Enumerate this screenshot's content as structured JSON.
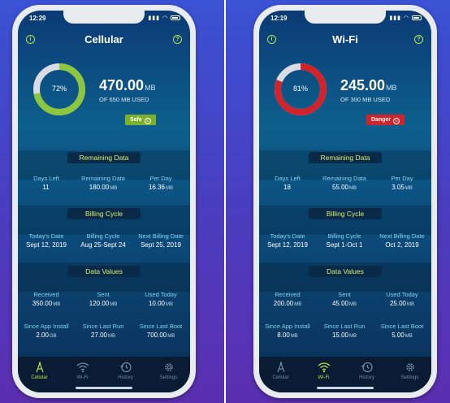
{
  "colors": {
    "accent_green": "#b6e34a",
    "danger_red": "#d2232a",
    "safe_green": "#8cc63f",
    "label_blue": "#7fd3f0"
  },
  "phones": [
    {
      "status_time": "12:29",
      "title": "Cellular",
      "gauge_percent_label": "72%",
      "gauge_fraction": 0.72,
      "gauge_color": "#8cc63f",
      "used_amount": "470.00",
      "used_unit": "MB",
      "used_sub": "OF 650 MB USED",
      "badge_label": "Safe",
      "badge_color": "#7ab02b",
      "sections": {
        "remaining": {
          "title": "Remaining Data",
          "cells": [
            {
              "label": "Days Left",
              "value": "11",
              "unit": ""
            },
            {
              "label": "Remaining Data",
              "value": "180.00",
              "unit": "MB"
            },
            {
              "label": "Per Day",
              "value": "16.36",
              "unit": "MB"
            }
          ]
        },
        "billing": {
          "title": "Billing Cycle",
          "cells": [
            {
              "label": "Today's Date",
              "value": "Sept 12, 2019",
              "unit": ""
            },
            {
              "label": "Billing Cycle",
              "value": "Aug 25-Sept 24",
              "unit": ""
            },
            {
              "label": "Next Billing Date",
              "value": "Sept 25, 2019",
              "unit": ""
            }
          ]
        },
        "values": {
          "title": "Data Values",
          "row1": [
            {
              "label": "Received",
              "value": "350.00",
              "unit": "MB"
            },
            {
              "label": "Sent",
              "value": "120.00",
              "unit": "MB"
            },
            {
              "label": "Used Today",
              "value": "10.00",
              "unit": "MB"
            }
          ],
          "row2": [
            {
              "label": "Since App Install",
              "value": "2.00",
              "unit": "GB"
            },
            {
              "label": "Since Last Run",
              "value": "27.00",
              "unit": "MB"
            },
            {
              "label": "Since Last Boot",
              "value": "700.00",
              "unit": "MB"
            }
          ]
        }
      },
      "active_tab": 0
    },
    {
      "status_time": "12:19",
      "title": "Wi-Fi",
      "gauge_percent_label": "81%",
      "gauge_fraction": 0.81,
      "gauge_color": "#d2232a",
      "used_amount": "245.00",
      "used_unit": "MB",
      "used_sub": "OF 300 MB USED",
      "badge_label": "Danger",
      "badge_color": "#d2232a",
      "sections": {
        "remaining": {
          "title": "Remaining Data",
          "cells": [
            {
              "label": "Days Left",
              "value": "18",
              "unit": ""
            },
            {
              "label": "Remaining Data",
              "value": "55.00",
              "unit": "MB"
            },
            {
              "label": "Per Day",
              "value": "3.05",
              "unit": "MB"
            }
          ]
        },
        "billing": {
          "title": "Billing Cycle",
          "cells": [
            {
              "label": "Today's Date",
              "value": "Sept 12, 2019",
              "unit": ""
            },
            {
              "label": "Billing Cycle",
              "value": "Sept 1-Oct 1",
              "unit": ""
            },
            {
              "label": "Next Billing Date",
              "value": "Oct 2, 2019",
              "unit": ""
            }
          ]
        },
        "values": {
          "title": "Data Values",
          "row1": [
            {
              "label": "Received",
              "value": "200.00",
              "unit": "MB"
            },
            {
              "label": "Sent",
              "value": "45.00",
              "unit": "MB"
            },
            {
              "label": "Used Today",
              "value": "25.00",
              "unit": "MB"
            }
          ],
          "row2": [
            {
              "label": "Since App Install",
              "value": "8.00",
              "unit": "MB"
            },
            {
              "label": "Since Last Run",
              "value": "15.00",
              "unit": "MB"
            },
            {
              "label": "Since Last Boot",
              "value": "5.00",
              "unit": "MB"
            }
          ]
        }
      },
      "active_tab": 1
    }
  ],
  "tabs": [
    {
      "label": "Cellular",
      "icon": "antenna-icon"
    },
    {
      "label": "Wi-Fi",
      "icon": "wifi-icon"
    },
    {
      "label": "History",
      "icon": "history-icon"
    },
    {
      "label": "Settings",
      "icon": "gear-icon"
    }
  ],
  "icons": {
    "info": "i",
    "help": "?",
    "smile": "☺"
  }
}
